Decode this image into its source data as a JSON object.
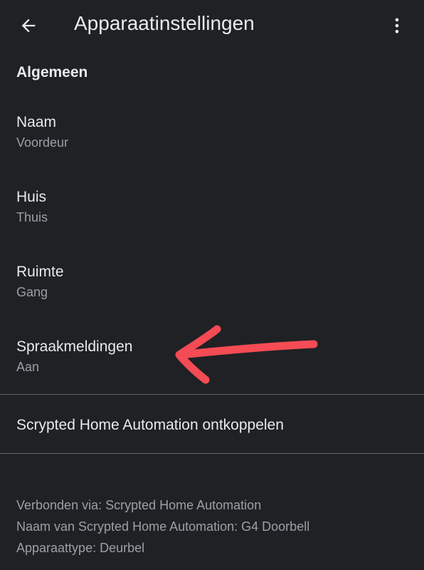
{
  "appbar": {
    "title": "Apparaatinstellingen",
    "back_icon": "arrow-back-icon",
    "menu_icon": "more-vert-icon"
  },
  "section": {
    "title": "Algemeen"
  },
  "settings": [
    {
      "label": "Naam",
      "value": "Voordeur"
    },
    {
      "label": "Huis",
      "value": "Thuis"
    },
    {
      "label": "Ruimte",
      "value": "Gang"
    },
    {
      "label": "Spraakmeldingen",
      "value": "Aan"
    }
  ],
  "unlink": {
    "label": "Scrypted Home Automation ontkoppelen"
  },
  "footer": {
    "lines": [
      "Verbonden via: Scrypted Home Automation",
      "Naam van Scrypted Home Automation: G4 Doorbell",
      "Apparaattype: Deurbel"
    ]
  },
  "colors": {
    "background": "#202124",
    "primary_text": "#e8eaed",
    "secondary_text": "#9aa0a6",
    "divider": "#5f6368",
    "annotation_arrow": "#f44b55"
  }
}
